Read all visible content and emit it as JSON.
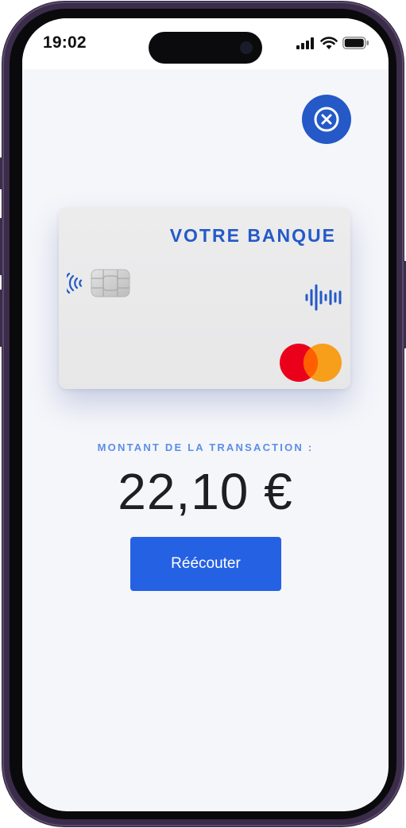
{
  "status_bar": {
    "time": "19:02",
    "icons": [
      "signal-icon",
      "wifi-icon",
      "battery-icon"
    ]
  },
  "close_button": {
    "icon": "close-circle-icon"
  },
  "card": {
    "bank_name": "VOTRE BANQUE",
    "icons": [
      "contactless-icon",
      "chip-icon",
      "sound-wave-icon",
      "mastercard-logo"
    ]
  },
  "transaction": {
    "label": "MONTANT DE LA TRANSACTION :",
    "amount": "22,10 €"
  },
  "actions": {
    "replay_label": "Réécouter"
  },
  "colors": {
    "brand_blue": "#2459c7",
    "button_blue": "#2561e3",
    "label_blue": "#5b8ee6",
    "background": "#f5f6fa",
    "mastercard_red": "#eb001b",
    "mastercard_orange": "#f79e1b"
  }
}
